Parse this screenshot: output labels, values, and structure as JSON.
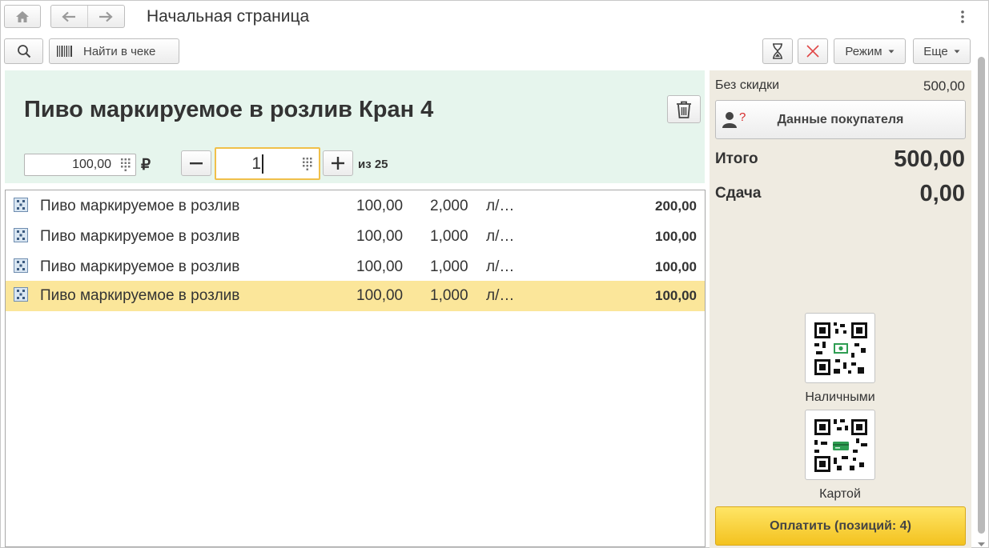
{
  "window": {
    "title": "Начальная страница"
  },
  "toolbar": {
    "find_in_receipt": "Найти в чеке",
    "mode_label": "Режим",
    "more_label": "Еще"
  },
  "product": {
    "title": "Пиво маркируемое в розлив Кран 4",
    "price": "100,00",
    "currency": "₽",
    "quantity": "1",
    "quantity_of": "из 25"
  },
  "receipt_rows": [
    {
      "name": "Пиво маркируемое в розлив",
      "price": "100,00",
      "qty": "2,000",
      "unit": "л/…",
      "sum": "200,00",
      "selected": false
    },
    {
      "name": "Пиво маркируемое в розлив",
      "price": "100,00",
      "qty": "1,000",
      "unit": "л/…",
      "sum": "100,00",
      "selected": false
    },
    {
      "name": "Пиво маркируемое в розлив",
      "price": "100,00",
      "qty": "1,000",
      "unit": "л/…",
      "sum": "100,00",
      "selected": false
    },
    {
      "name": "Пиво маркируемое в розлив",
      "price": "100,00",
      "qty": "1,000",
      "unit": "л/…",
      "sum": "100,00",
      "selected": true
    }
  ],
  "summary": {
    "no_discount_label": "Без скидки",
    "no_discount_value": "500,00",
    "customer_data_label": "Данные покупателя",
    "total_label": "Итого",
    "total_value": "500,00",
    "change_label": "Сдача",
    "change_value": "0,00",
    "pay_cash_label": "Наличными",
    "pay_card_label": "Картой",
    "pay_button_label": "Оплатить (позиций: 4)"
  },
  "colors": {
    "panel_green": "#e6f5ed",
    "side_bg": "#efebe1",
    "selected_row": "#fbe69a",
    "pay_yellow": "#f3c21f",
    "focus_border": "#f0c04a",
    "qr_green": "#2e9d52"
  }
}
